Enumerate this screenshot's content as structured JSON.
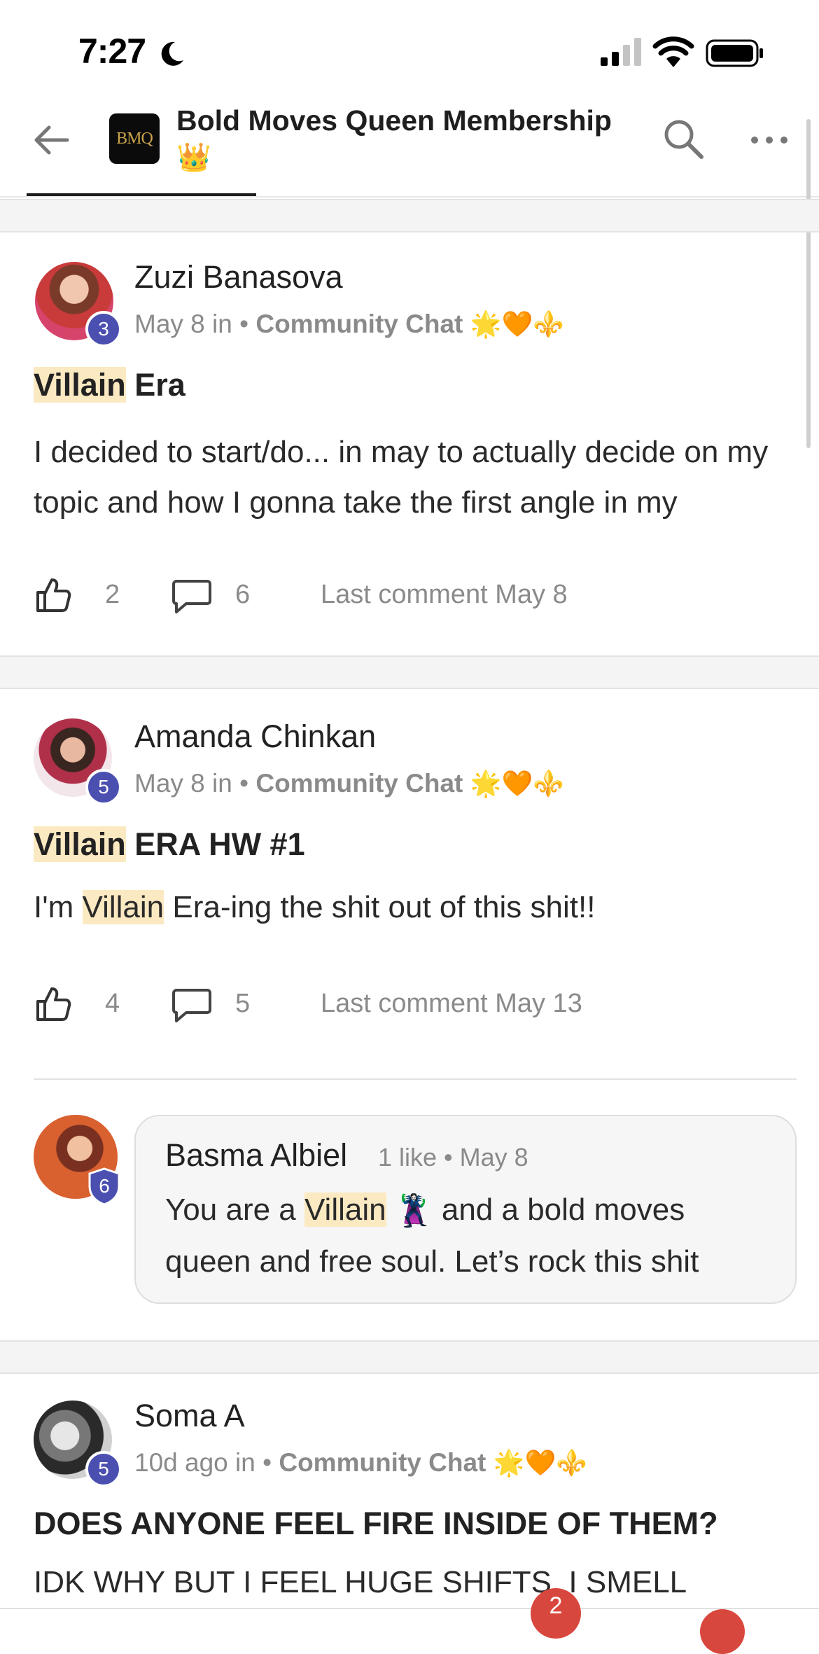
{
  "status": {
    "time": "7:27"
  },
  "header": {
    "back_label": "Back",
    "logo_text": "BMQ",
    "group_title": "Bold Moves Queen Membership",
    "group_emoji": "👑"
  },
  "posts": [
    {
      "author": "Zuzi Banasova",
      "level": "3",
      "meta_prefix": "May 8 in • ",
      "channel": "Community Chat",
      "channel_emojis": "🌟🧡⚜️",
      "title_highlight": "Villain",
      "title_rest": " Era",
      "body": "I decided to start/do... in may to actually decide on my topic and how I gonna take the first angle in my",
      "likes": "2",
      "comments": "6",
      "last_comment": "Last comment May 8"
    },
    {
      "author": "Amanda Chinkan",
      "level": "5",
      "meta_prefix": "May 8 in • ",
      "channel": "Community Chat",
      "channel_emojis": "🌟🧡⚜️",
      "title_highlight": "Villain",
      "title_rest": " ERA HW #1",
      "body_prefix": "I'm ",
      "body_highlight": "Villain",
      "body_rest": " Era-ing the shit out of this shit!!",
      "likes": "4",
      "comments": "5",
      "last_comment": "Last comment May 13",
      "top_comment": {
        "author": "Basma Albiel",
        "level": "6",
        "meta": "1 like • May 8",
        "text_prefix": "You are a ",
        "text_highlight": "Villain",
        "text_emoji": "🦹‍♀️",
        "text_rest": " and a bold moves queen and free soul. Let’s rock this shit"
      }
    },
    {
      "author": "Soma A",
      "level": "5",
      "meta_prefix": "10d ago in • ",
      "channel": "Community Chat",
      "channel_emojis": "🌟🧡⚜️",
      "title": "DOES ANYONE FEEL FIRE INSIDE OF THEM?",
      "body": "IDK WHY BUT I FEEL HUGE SHIFTS. I SMELL"
    }
  ],
  "bottom_nav": {
    "notification_count": "2"
  },
  "colors": {
    "level_badge": "#4a4fb0",
    "highlight": "#fbe9c2",
    "notification": "#d8473d"
  }
}
